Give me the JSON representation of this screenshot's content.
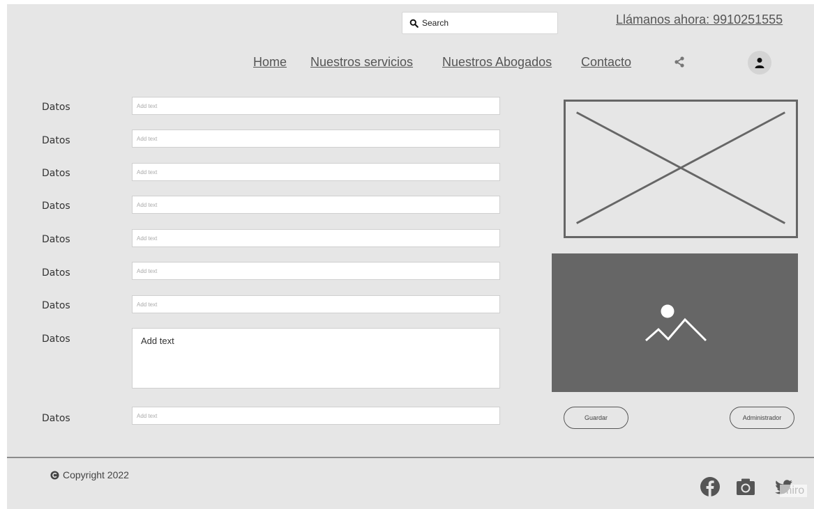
{
  "header": {
    "search": {
      "placeholder": "Search",
      "icon": "search-icon"
    },
    "phone": "Llámanos ahora: 9910251555",
    "nav": [
      {
        "label": "Home"
      },
      {
        "label": "Nuestros servicios"
      },
      {
        "label": "Nuestros Abogados"
      },
      {
        "label": "Contacto"
      }
    ],
    "share_icon": "share-icon",
    "avatar_icon": "user-icon"
  },
  "form": {
    "label": "Datos",
    "placeholder": "Add text",
    "rows": [
      {
        "label": "Datos",
        "placeholder": "Add text"
      },
      {
        "label": "Datos",
        "placeholder": "Add text"
      },
      {
        "label": "Datos",
        "placeholder": "Add text"
      },
      {
        "label": "Datos",
        "placeholder": "Add text"
      },
      {
        "label": "Datos",
        "placeholder": "Add text"
      },
      {
        "label": "Datos",
        "placeholder": "Add text"
      },
      {
        "label": "Datos",
        "placeholder": "Add text"
      },
      {
        "label": "Datos",
        "placeholder": "Add text"
      },
      {
        "label": "Datos",
        "placeholder": "Add text"
      }
    ]
  },
  "actions": {
    "save_label": "Guardar",
    "admin_label": "Administrador"
  },
  "footer": {
    "copyright": "Copyright 2022",
    "social_icons": [
      "facebook-icon",
      "camera-icon",
      "twitter-icon"
    ],
    "watermark": "miro"
  },
  "colors": {
    "background": "#e6e6e6",
    "text": "#555555",
    "image_fill": "#666666",
    "input_bg": "#ffffff"
  }
}
